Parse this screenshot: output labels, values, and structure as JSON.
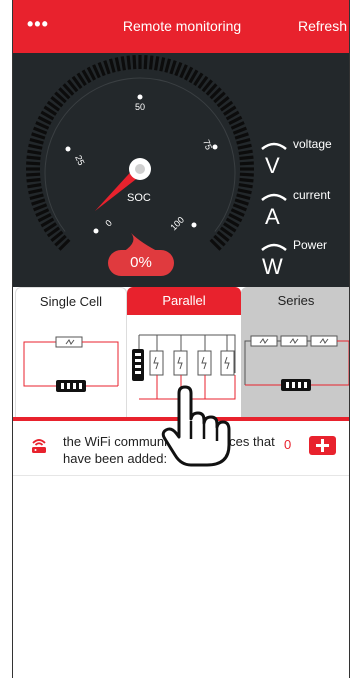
{
  "header": {
    "menu_label": "•••",
    "title": "Remote monitoring",
    "refresh_label": "Refresh"
  },
  "gauge": {
    "scale_labels": [
      "0",
      "25",
      "50",
      "75",
      "100"
    ],
    "center_label": "SOC",
    "soc_value": "0%",
    "soc_level": 0
  },
  "metrics": [
    {
      "symbol": "V",
      "label": "voltage"
    },
    {
      "symbol": "A",
      "label": "current"
    },
    {
      "symbol": "W",
      "label": "Power"
    }
  ],
  "tabs": {
    "single": "Single Cell",
    "parallel": "Parallel",
    "series": "Series",
    "selected": "Parallel"
  },
  "devices": {
    "text": "the WiFi communication devices that have been added:",
    "count": "0"
  },
  "colors": {
    "brand_red": "#e8222d",
    "panel_dark": "#23282b",
    "badge_red": "#e03a3e"
  },
  "icons": {
    "menu": "more-dots-icon",
    "router": "wifi-router-icon",
    "add": "plus-icon",
    "hand": "pointing-hand-icon"
  }
}
